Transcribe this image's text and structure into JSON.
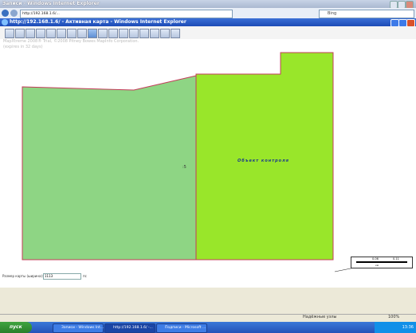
{
  "outer_window": {
    "title": "Записи - Windows Internet Explorer",
    "url": "http://192.168.1.6/...",
    "search_placeholder": "Bing"
  },
  "popup": {
    "title": "http://192.168.1.6/ - Активная карта - Windows Internet Explorer"
  },
  "toolbar": {
    "tools": [
      "home-icon",
      "zoom-in-icon",
      "zoom-out-icon",
      "pan-icon",
      "info-icon",
      "select-icon",
      "select-radius-icon",
      "select-polygon-icon",
      "layers-icon",
      "legend-icon",
      "ruler-icon",
      "print-icon",
      "clear-icon",
      "refresh-icon",
      "export-icon",
      "save-icon",
      "settings-icon"
    ]
  },
  "map": {
    "copyright": "MapXtreme 2008® Trial, ©2008 Pitney Bowes MapInfo Corporation.",
    "expires": "(expires in 32 days)",
    "region_label": "Объект контроля",
    "region_number": ":5",
    "left_region_color": "#8ed584",
    "right_region_color": "#99e62a",
    "border_color": "#c43c5a"
  },
  "scalebar": {
    "label_a": "0.06",
    "label_b": "0.11",
    "units": "км"
  },
  "size_control": {
    "label": "Размер карты (ширина):",
    "value": "1113",
    "unit": "пс"
  },
  "status": {
    "zone": "Надёжные узлы",
    "zoom": "100%"
  },
  "taskbar": {
    "start": "пуск",
    "tasks": [
      "Записи - Windows Int...",
      "http://192.168.1.6/ -...",
      "Подписи - Microsoft ..."
    ],
    "clock": "13:36"
  }
}
